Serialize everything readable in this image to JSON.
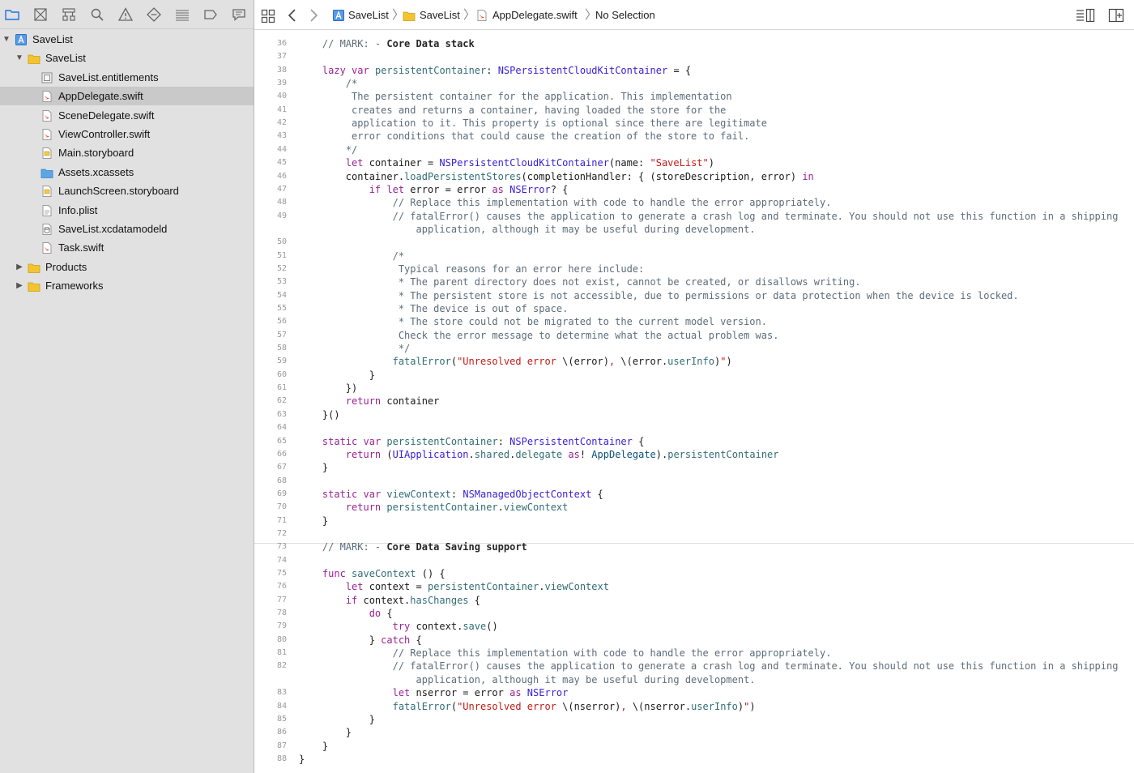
{
  "navigator": {
    "toolbar_icons": [
      "folder-icon",
      "source-control-icon",
      "hierarchy-icon",
      "search-icon",
      "warning-icon",
      "test-icon",
      "debug-icon",
      "breakpoint-icon",
      "report-icon"
    ],
    "tree": [
      {
        "name": "SaveList",
        "kind": "project",
        "level": 0,
        "expanded": true
      },
      {
        "name": "SaveList",
        "kind": "folder",
        "level": 1,
        "expanded": true
      },
      {
        "name": "SaveList.entitlements",
        "kind": "entitlements",
        "level": 2
      },
      {
        "name": "AppDelegate.swift",
        "kind": "swift",
        "level": 2,
        "selected": true
      },
      {
        "name": "SceneDelegate.swift",
        "kind": "swift",
        "level": 2
      },
      {
        "name": "ViewController.swift",
        "kind": "swift",
        "level": 2
      },
      {
        "name": "Main.storyboard",
        "kind": "storyboard",
        "level": 2
      },
      {
        "name": "Assets.xcassets",
        "kind": "assets",
        "level": 2
      },
      {
        "name": "LaunchScreen.storyboard",
        "kind": "storyboard",
        "level": 2
      },
      {
        "name": "Info.plist",
        "kind": "plist",
        "level": 2
      },
      {
        "name": "SaveList.xcdatamodeld",
        "kind": "datamodel",
        "level": 2
      },
      {
        "name": "Task.swift",
        "kind": "swift",
        "level": 2
      },
      {
        "name": "Products",
        "kind": "folder",
        "level": 1,
        "expanded": false
      },
      {
        "name": "Frameworks",
        "kind": "folder",
        "level": 1,
        "expanded": false
      }
    ]
  },
  "jumpbar": {
    "crumbs": [
      "SaveList",
      "SaveList",
      "AppDelegate.swift",
      "No Selection"
    ]
  },
  "editor": {
    "lines": [
      {
        "n": "36",
        "t": "    // MARK: - Core Data stack"
      },
      {
        "n": "37",
        "t": ""
      },
      {
        "n": "38",
        "t": "    lazy var persistentContainer: NSPersistentCloudKitContainer = {"
      },
      {
        "n": "39",
        "t": "        /*"
      },
      {
        "n": "40",
        "t": "         The persistent container for the application. This implementation"
      },
      {
        "n": "41",
        "t": "         creates and returns a container, having loaded the store for the"
      },
      {
        "n": "42",
        "t": "         application to it. This property is optional since there are legitimate"
      },
      {
        "n": "43",
        "t": "         error conditions that could cause the creation of the store to fail."
      },
      {
        "n": "44",
        "t": "        */"
      },
      {
        "n": "45",
        "t": "        let container = NSPersistentCloudKitContainer(name: \"SaveList\")"
      },
      {
        "n": "46",
        "t": "        container.loadPersistentStores(completionHandler: { (storeDescription, error) in"
      },
      {
        "n": "47",
        "t": "            if let error = error as NSError? {"
      },
      {
        "n": "48",
        "t": "                // Replace this implementation with code to handle the error appropriately."
      },
      {
        "n": "49",
        "t": "                // fatalError() causes the application to generate a crash log and terminate. You should not use this function in a shipping"
      },
      {
        "n": "",
        "t": "                    application, although it may be useful during development."
      },
      {
        "n": "50",
        "t": ""
      },
      {
        "n": "51",
        "t": "                /*"
      },
      {
        "n": "52",
        "t": "                 Typical reasons for an error here include:"
      },
      {
        "n": "53",
        "t": "                 * The parent directory does not exist, cannot be created, or disallows writing."
      },
      {
        "n": "54",
        "t": "                 * The persistent store is not accessible, due to permissions or data protection when the device is locked."
      },
      {
        "n": "55",
        "t": "                 * The device is out of space."
      },
      {
        "n": "56",
        "t": "                 * The store could not be migrated to the current model version."
      },
      {
        "n": "57",
        "t": "                 Check the error message to determine what the actual problem was."
      },
      {
        "n": "58",
        "t": "                 */"
      },
      {
        "n": "59",
        "t": "                fatalError(\"Unresolved error \\(error), \\(error.userInfo)\")"
      },
      {
        "n": "60",
        "t": "            }"
      },
      {
        "n": "61",
        "t": "        })"
      },
      {
        "n": "62",
        "t": "        return container"
      },
      {
        "n": "63",
        "t": "    }()"
      },
      {
        "n": "64",
        "t": ""
      },
      {
        "n": "65",
        "t": "    static var persistentContainer: NSPersistentContainer {"
      },
      {
        "n": "66",
        "t": "        return (UIApplication.shared.delegate as! AppDelegate).persistentContainer"
      },
      {
        "n": "67",
        "t": "    }"
      },
      {
        "n": "68",
        "t": ""
      },
      {
        "n": "69",
        "t": "    static var viewContext: NSManagedObjectContext {"
      },
      {
        "n": "70",
        "t": "        return persistentContainer.viewContext"
      },
      {
        "n": "71",
        "t": "    }"
      },
      {
        "n": "72",
        "t": ""
      },
      {
        "n": "73",
        "t": "    // MARK: - Core Data Saving support"
      },
      {
        "n": "74",
        "t": ""
      },
      {
        "n": "75",
        "t": "    func saveContext () {"
      },
      {
        "n": "76",
        "t": "        let context = persistentContainer.viewContext"
      },
      {
        "n": "77",
        "t": "        if context.hasChanges {"
      },
      {
        "n": "78",
        "t": "            do {"
      },
      {
        "n": "79",
        "t": "                try context.save()"
      },
      {
        "n": "80",
        "t": "            } catch {"
      },
      {
        "n": "81",
        "t": "                // Replace this implementation with code to handle the error appropriately."
      },
      {
        "n": "82",
        "t": "                // fatalError() causes the application to generate a crash log and terminate. You should not use this function in a shipping"
      },
      {
        "n": "",
        "t": "                    application, although it may be useful during development."
      },
      {
        "n": "83",
        "t": "                let nserror = error as NSError"
      },
      {
        "n": "84",
        "t": "                fatalError(\"Unresolved error \\(nserror), \\(nserror.userInfo)\")"
      },
      {
        "n": "85",
        "t": "            }"
      },
      {
        "n": "86",
        "t": "        }"
      },
      {
        "n": "87",
        "t": "    }"
      },
      {
        "n": "88",
        "t": "}"
      }
    ]
  },
  "colors": {
    "keyword": "#9b2393",
    "type": "#3a20d8",
    "project_type": "#0b4f79",
    "function": "#326d74",
    "string": "#c41a16",
    "comment": "#5d6c79",
    "folder": "#f4c430",
    "swift": "#f05138",
    "accent": "#1a73e8"
  }
}
